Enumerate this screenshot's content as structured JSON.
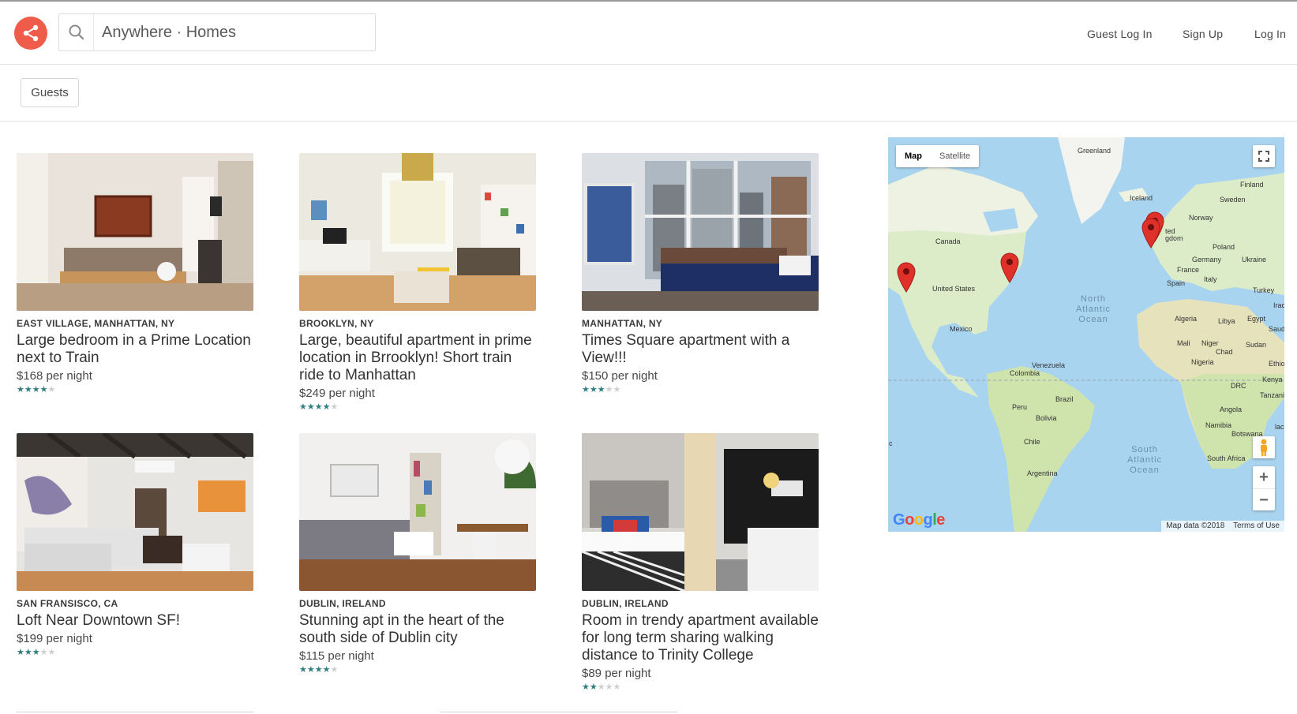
{
  "header": {
    "search_text": "Anywhere · Homes",
    "nav": [
      "Guest Log In",
      "Sign Up",
      "Log In"
    ]
  },
  "filters": {
    "guests_label": "Guests"
  },
  "listings": [
    {
      "location": "EAST VILLAGE, MANHATTAN, NY",
      "title": "Large bedroom in a Prime Location next to Train",
      "price": "$168 per night",
      "rating": 4
    },
    {
      "location": "BROOKLYN, NY",
      "title": "Large, beautiful apartment in prime location in Brrooklyn! Short train ride to Manhattan",
      "price": "$249 per night",
      "rating": 4
    },
    {
      "location": "MANHATTAN, NY",
      "title": "Times Square apartment with a View!!!",
      "price": "$150 per night",
      "rating": 3
    },
    {
      "location": "SAN FRANSISCO, CA",
      "title": "Loft Near Downtown SF!",
      "price": "$199 per night",
      "rating": 3
    },
    {
      "location": "DUBLIN, IRELAND",
      "title": "Stunning apt in the heart of the south side of Dublin city",
      "price": "$115 per night",
      "rating": 4
    },
    {
      "location": "DUBLIN, IRELAND",
      "title": "Room in trendy apartment available for long term sharing walking distance to Trinity College",
      "price": "$89 per night",
      "rating": 2
    }
  ],
  "map": {
    "toggle": [
      "Map",
      "Satellite"
    ],
    "labels": {
      "greenland": "Greenland",
      "iceland": "Iceland",
      "finland": "Finland",
      "sweden": "Sweden",
      "norway": "Norway",
      "uk": "ted\ngdom",
      "poland": "Poland",
      "germany": "Germany",
      "ukraine": "Ukraine",
      "france": "France",
      "italy": "Italy",
      "spain": "Spain",
      "turkey": "Turkey",
      "iraq": "Irac",
      "canada": "Canada",
      "us": "United States",
      "mexico": "Mexico",
      "algeria": "Algeria",
      "libya": "Libya",
      "egypt": "Egypt",
      "saudi": "Saudi",
      "mali": "Mali",
      "niger": "Niger",
      "sudan": "Sudan",
      "chad": "Chad",
      "nigeria": "Nigeria",
      "ethiopia": "Ethiopia",
      "venezuela": "Venezuela",
      "colombia": "Colombia",
      "kenya": "Kenya",
      "drc": "DRC",
      "tanzania": "Tanzania",
      "brazil": "Brazil",
      "peru": "Peru",
      "bolivia": "Bolivia",
      "angola": "Angola",
      "namibia": "Namibia",
      "botswana": "Botswana",
      "chile": "Chile",
      "south_africa": "South Africa",
      "argentina": "Argentina",
      "madagascar_cut": "lac",
      "edge_c": "c"
    },
    "ocean_north": "North\nAtlantic\nOcean",
    "ocean_south": "South\nAtlantic\nOcean",
    "google": "Google",
    "map_data": "Map data ©2018",
    "terms": "Terms of Use",
    "markers": [
      "San Francisco",
      "New York",
      "Dublin",
      "Dublin"
    ]
  },
  "colors": {
    "brand": "#f05c4a",
    "star": "#2f7f82",
    "marker": "#e0302a"
  }
}
